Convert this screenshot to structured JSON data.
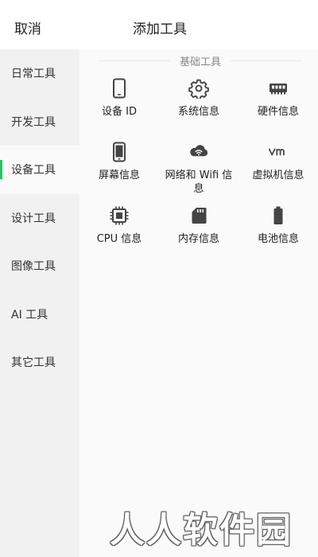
{
  "header": {
    "cancel_label": "取消",
    "title": "添加工具"
  },
  "sidebar": {
    "items": [
      {
        "label": "日常工具",
        "active": false
      },
      {
        "label": "开发工具",
        "active": false
      },
      {
        "label": "设备工具",
        "active": true
      },
      {
        "label": "设计工具",
        "active": false
      },
      {
        "label": "图像工具",
        "active": false
      },
      {
        "label": "AI 工具",
        "active": false
      },
      {
        "label": "其它工具",
        "active": false
      }
    ]
  },
  "main": {
    "section_title": "基础工具",
    "tools": [
      {
        "label": "设备 ID",
        "icon": "phone-icon"
      },
      {
        "label": "系统信息",
        "icon": "gear-icon"
      },
      {
        "label": "硬件信息",
        "icon": "memory-icon"
      },
      {
        "label": "屏幕信息",
        "icon": "screen-icon"
      },
      {
        "label": "网络和 Wifi 信息",
        "icon": "cloud-wifi-icon"
      },
      {
        "label": "虚拟机信息",
        "icon": "vm-icon"
      },
      {
        "label": "CPU 信息",
        "icon": "cpu-icon"
      },
      {
        "label": "内存信息",
        "icon": "sd-card-icon"
      },
      {
        "label": "电池信息",
        "icon": "battery-icon"
      }
    ]
  },
  "colors": {
    "accent": "#22c55e",
    "sidebar_bg": "#f1f1f1",
    "content_bg": "#fafafa"
  },
  "watermark": "人人软件园"
}
